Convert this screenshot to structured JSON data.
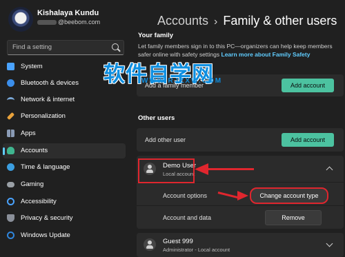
{
  "profile": {
    "name": "Kishalaya Kundu",
    "email": "@beebom.com"
  },
  "search": {
    "placeholder": "Find a setting"
  },
  "sidebar": {
    "items": [
      {
        "label": "System",
        "icon": "monitor-icon",
        "color": "#4aa3ff"
      },
      {
        "label": "Bluetooth & devices",
        "icon": "bluetooth-icon",
        "color": "#3b8eea"
      },
      {
        "label": "Network & internet",
        "icon": "wifi-icon",
        "color": "#7aa8d8"
      },
      {
        "label": "Personalization",
        "icon": "brush-icon",
        "color": "#e9a23b"
      },
      {
        "label": "Apps",
        "icon": "apps-icon",
        "color": "#8a9bb5"
      },
      {
        "label": "Accounts",
        "icon": "person-icon",
        "color": "#3fb58f",
        "active": true
      },
      {
        "label": "Time & language",
        "icon": "globe-clock-icon",
        "color": "#3b9ee0"
      },
      {
        "label": "Gaming",
        "icon": "gamepad-icon",
        "color": "#9aa0a6"
      },
      {
        "label": "Accessibility",
        "icon": "accessibility-icon",
        "color": "#4aa3ff"
      },
      {
        "label": "Privacy & security",
        "icon": "shield-icon",
        "color": "#8a8f99"
      },
      {
        "label": "Windows Update",
        "icon": "update-icon",
        "color": "#2f86dd"
      }
    ]
  },
  "breadcrumb": {
    "parent": "Accounts",
    "separator": "›",
    "current": "Family & other users"
  },
  "family": {
    "title": "Your family",
    "description": "Let family members sign in to this PC—organizers can help keep members safer online with safety settings",
    "link": "Learn more about Family Safety",
    "add_label": "Add a family member",
    "add_button": "Add account"
  },
  "other_users": {
    "title": "Other users",
    "add_label": "Add other user",
    "add_button": "Add account",
    "demo_user": {
      "name": "Demo User",
      "type": "Local account",
      "options_label": "Account options",
      "change_button": "Change account type",
      "data_label": "Account and data",
      "remove_button": "Remove"
    },
    "guest": {
      "name": "Guest 999",
      "type": "Administrator - Local account"
    }
  },
  "watermark": {
    "text": "软件自学网",
    "url": "WWW.RJZXW.COM"
  },
  "colors": {
    "accent": "#4cc2a0",
    "link": "#60cdff",
    "annotation": "#e0262e"
  }
}
